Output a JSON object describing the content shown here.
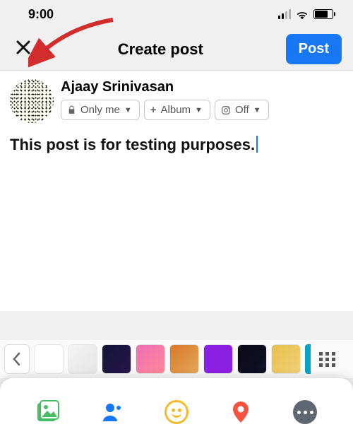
{
  "statusbar": {
    "time": "9:00"
  },
  "nav": {
    "title": "Create post",
    "post_button": "Post"
  },
  "author": {
    "name": "Ajaay Srinivasan",
    "privacy_label": "Only me",
    "album_label": "Album",
    "instagram_label": "Off"
  },
  "composer": {
    "text": "This post is for testing purposes."
  },
  "background_picker": {
    "swatches": [
      {
        "id": "blank",
        "style": "background:#ffffff;"
      },
      {
        "id": "light-texture",
        "style": "background:linear-gradient(135deg,#f3f3f3,#e6e6e6);"
      },
      {
        "id": "rocket-navy",
        "style": "background:linear-gradient(135deg,#121438,#27164a);"
      },
      {
        "id": "pink-wave",
        "style": "background:linear-gradient(135deg,#ed6fb4,#ff8899);"
      },
      {
        "id": "orange-path",
        "style": "background:linear-gradient(135deg,#d97a28,#e3a65a);"
      },
      {
        "id": "purple-solid",
        "style": "background:#8b20e3;"
      },
      {
        "id": "dark-lines",
        "style": "background:linear-gradient(135deg,#0a0a16,#11112a);"
      },
      {
        "id": "yellow-illustration",
        "style": "background:linear-gradient(135deg,#e7c04c,#f1d078);"
      }
    ],
    "partial_next": {
      "id": "teal",
      "style": "background:#00a7c4;"
    }
  },
  "colors": {
    "accent": "#1877f2",
    "arrow": "#d22d2d"
  }
}
